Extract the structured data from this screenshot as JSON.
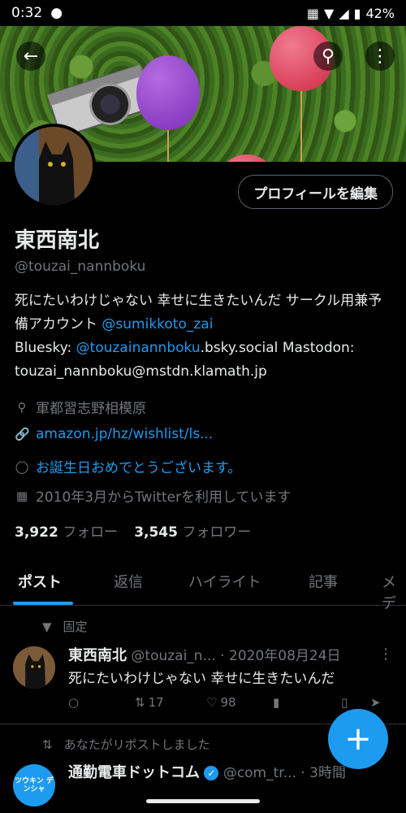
{
  "status_bar": {
    "time": "0:32",
    "battery": "42%"
  },
  "profile": {
    "edit_label": "プロフィールを編集",
    "name": "東西南北",
    "handle": "@touzai_nannboku",
    "bio_part1": "死にたいわけじゃない 幸せに生きたいんだ サークル用兼予備アカウント ",
    "bio_link1": "@sumikkoto_zai",
    "bio_part2": "Bluesky: ",
    "bio_link2": "@touzainannboku",
    "bio_part3": ".bsky.social Mastodon: touzai_nannboku@mstdn.klamath.jp",
    "location": "軍都習志野相模原",
    "website": "amazon.jp/hz/wishlist/ls...",
    "birthday": "お誕生日おめでとうございます。",
    "joined": "2010年3月からTwitterを利用しています",
    "following_count": "3,922",
    "following_label": "フォロー",
    "followers_count": "3,545",
    "followers_label": "フォロワー"
  },
  "tabs": [
    "ポスト",
    "返信",
    "ハイライト",
    "記事",
    "メデ"
  ],
  "pinned_tweet": {
    "pinned_label": "固定",
    "name": "東西南北",
    "handle": "@touzai_n...",
    "date": "· 2020年08月24日",
    "text": "死にたいわけじゃない 幸せに生きたいんだ",
    "retweets": "17",
    "likes": "98"
  },
  "repost": {
    "note": "あなたがリポストしました",
    "name": "通勤電車ドットコム",
    "handle": "@com_tr...",
    "time": "· 3時間",
    "avatar_text": "ツウキン デンシャ"
  },
  "icons": {
    "back": "back-arrow-icon",
    "search": "search-icon",
    "more": "more-icon",
    "location": "location-icon",
    "link": "link-icon",
    "balloon": "balloon-icon",
    "calendar": "calendar-icon",
    "pin": "pin-icon",
    "reply": "reply-icon",
    "retweet": "retweet-icon",
    "like": "like-icon",
    "views": "views-icon",
    "bookmark": "bookmark-icon",
    "share": "share-icon",
    "compose": "compose-icon"
  },
  "colors": {
    "accent": "#1d9bf0",
    "background": "#000000",
    "text": "#e7e9ea",
    "muted": "#71767b"
  }
}
